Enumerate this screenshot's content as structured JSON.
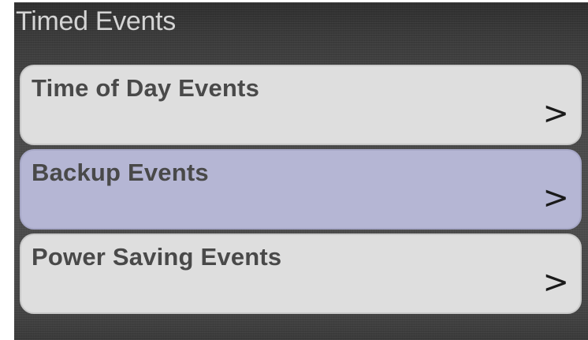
{
  "header": {
    "title": "Timed Events"
  },
  "menu": {
    "items": [
      {
        "label": "Time of Day Events",
        "chevron": ">",
        "selected": false
      },
      {
        "label": "Backup Events",
        "chevron": ">",
        "selected": true
      },
      {
        "label": "Power Saving Events",
        "chevron": ">",
        "selected": false
      }
    ]
  },
  "colors": {
    "background": "#474747",
    "item_background": "#dedede",
    "item_selected_background": "#b5b6d4",
    "title_text": "#d4d4d4",
    "item_text": "#494949"
  },
  "icons": {
    "chevron": "chevron-right-icon"
  }
}
